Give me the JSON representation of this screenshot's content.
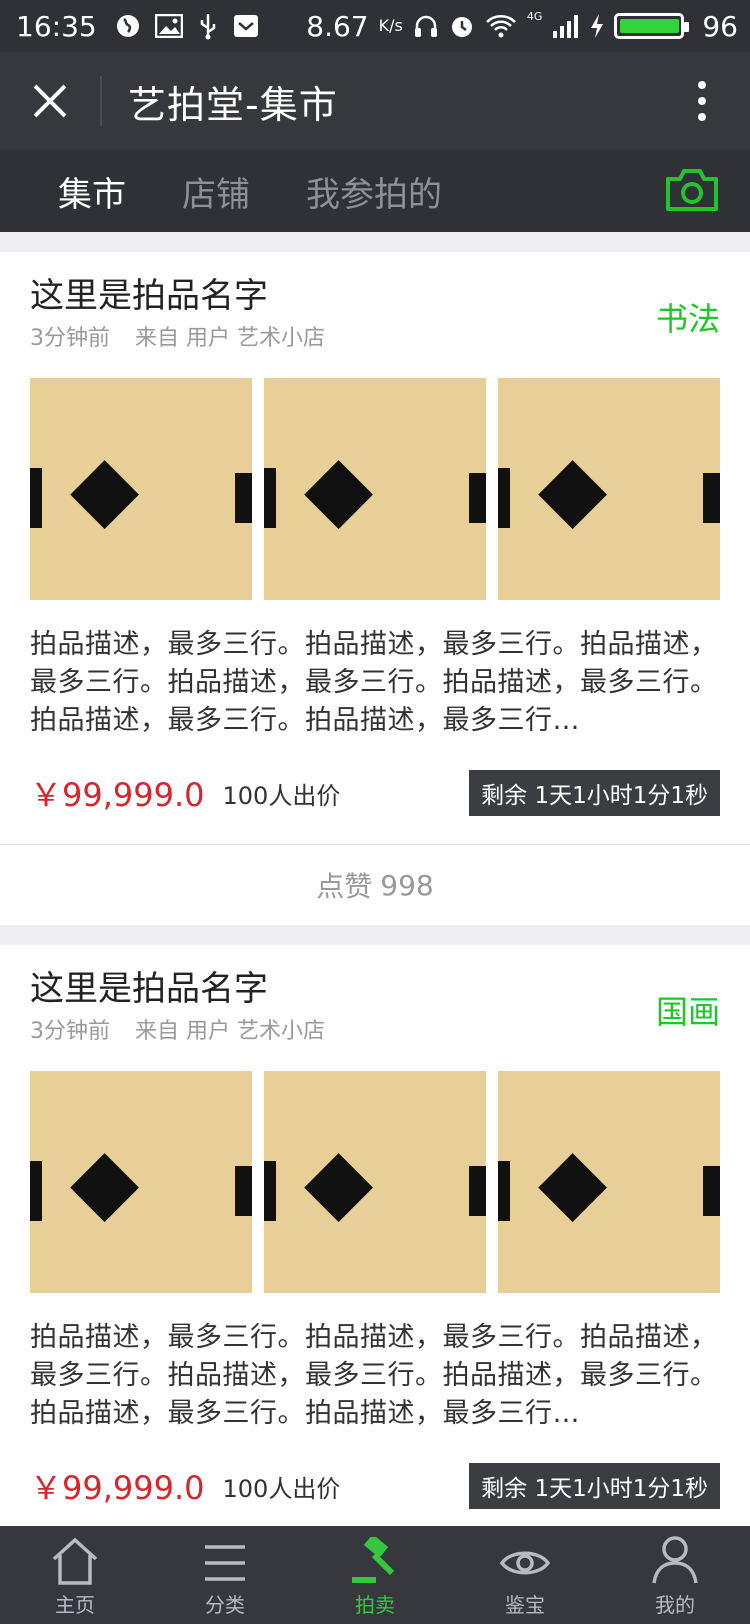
{
  "statusbar": {
    "time": "16:35",
    "speed": "8.67",
    "speed_unit": "K/s",
    "network": "4G",
    "battery": "96",
    "battery_color": "#35d23b"
  },
  "titlebar": {
    "title": "艺拍堂-集市"
  },
  "tabs": [
    {
      "label": "集市",
      "active": true
    },
    {
      "label": "店铺",
      "active": false
    },
    {
      "label": "我参拍的",
      "active": false
    }
  ],
  "accent_color": "#21c52b",
  "price_color": "#d5262d",
  "cards": [
    {
      "title": "这里是拍品名字",
      "time": "3分钟前",
      "source": "来自 用户 艺术小店",
      "tag": "书法",
      "description": "拍品描述，最多三行。拍品描述，最多三行。拍品描述，最多三行。拍品描述，最多三行。拍品描述，最多三行。拍品描述，最多三行。拍品描述，最多三行…",
      "price": "￥99,999.0",
      "bids": "100人出价",
      "remaining": "剩余 1天1小时1分1秒",
      "likes_label": "点赞",
      "likes_count": "998"
    },
    {
      "title": "这里是拍品名字",
      "time": "3分钟前",
      "source": "来自 用户 艺术小店",
      "tag": "国画",
      "description": "拍品描述，最多三行。拍品描述，最多三行。拍品描述，最多三行。拍品描述，最多三行。拍品描述，最多三行。拍品描述，最多三行。拍品描述，最多三行…",
      "price": "￥99,999.0",
      "bids": "100人出价",
      "remaining": "剩余 1天1小时1分1秒"
    }
  ],
  "bottomnav": [
    {
      "label": "主页",
      "icon": "home-icon",
      "active": false
    },
    {
      "label": "分类",
      "icon": "menu-icon",
      "active": false
    },
    {
      "label": "拍卖",
      "icon": "gavel-icon",
      "active": true
    },
    {
      "label": "鉴宝",
      "icon": "eye-icon",
      "active": false
    },
    {
      "label": "我的",
      "icon": "user-icon",
      "active": false
    }
  ]
}
